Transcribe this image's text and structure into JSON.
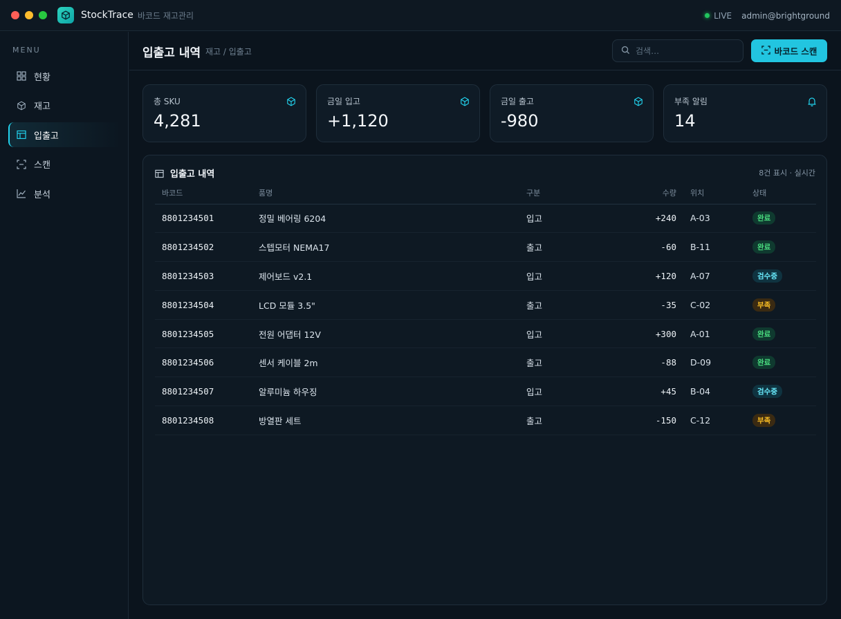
{
  "window": {
    "app_name": "StockTrace",
    "app_subtitle": "바코드 재고관리",
    "live_label": "LIVE",
    "user": "admin@brightground"
  },
  "sidebar": {
    "menu_label": "MENU",
    "items": [
      {
        "label": "현황",
        "icon": "grid-icon",
        "active": false
      },
      {
        "label": "재고",
        "icon": "box-icon",
        "active": false
      },
      {
        "label": "입출고",
        "icon": "table-icon",
        "active": true
      },
      {
        "label": "스캔",
        "icon": "scan-icon",
        "active": false
      },
      {
        "label": "분석",
        "icon": "chart-icon",
        "active": false
      }
    ]
  },
  "header": {
    "title": "입출고 내역",
    "breadcrumb": "재고 / 입출고",
    "search_placeholder": "검색…",
    "scan_button": "바코드 스캔"
  },
  "stats": [
    {
      "label": "총 SKU",
      "value": "4,281",
      "icon": "box-icon"
    },
    {
      "label": "금일 입고",
      "value": "+1,120",
      "icon": "box-icon"
    },
    {
      "label": "금일 출고",
      "value": "-980",
      "icon": "box-icon"
    },
    {
      "label": "부족 알림",
      "value": "14",
      "icon": "bell-icon"
    }
  ],
  "panel": {
    "title": "입출고 내역",
    "meta": "8건 표시 · 실시간",
    "columns": [
      "바코드",
      "품명",
      "구분",
      "수량",
      "위치",
      "상태"
    ],
    "rows": [
      {
        "barcode": "8801234501",
        "name": "정밀 베어링 6204",
        "type": "입고",
        "qty": "+240",
        "location": "A-03",
        "status": "완료"
      },
      {
        "barcode": "8801234502",
        "name": "스텝모터 NEMA17",
        "type": "출고",
        "qty": "-60",
        "location": "B-11",
        "status": "완료"
      },
      {
        "barcode": "8801234503",
        "name": "제어보드 v2.1",
        "type": "입고",
        "qty": "+120",
        "location": "A-07",
        "status": "검수중"
      },
      {
        "barcode": "8801234504",
        "name": "LCD 모듈 3.5\"",
        "type": "출고",
        "qty": "-35",
        "location": "C-02",
        "status": "부족"
      },
      {
        "barcode": "8801234505",
        "name": "전원 어댑터 12V",
        "type": "입고",
        "qty": "+300",
        "location": "A-01",
        "status": "완료"
      },
      {
        "barcode": "8801234506",
        "name": "센서 케이블 2m",
        "type": "출고",
        "qty": "-88",
        "location": "D-09",
        "status": "완료"
      },
      {
        "barcode": "8801234507",
        "name": "알루미늄 하우징",
        "type": "입고",
        "qty": "+45",
        "location": "B-04",
        "status": "검수중"
      },
      {
        "barcode": "8801234508",
        "name": "방열판 세트",
        "type": "출고",
        "qty": "-150",
        "location": "C-12",
        "status": "부족"
      }
    ]
  },
  "colors": {
    "accent": "#22c5e0",
    "status_done": "#4ade80",
    "status_check": "#67e8f9",
    "status_short": "#fbbf24"
  }
}
